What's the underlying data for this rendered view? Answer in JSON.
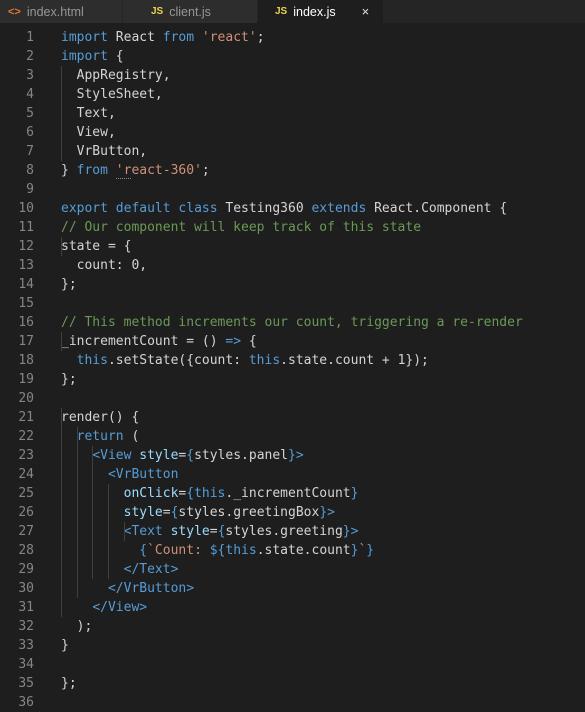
{
  "tabs": [
    {
      "label": "index.html",
      "icon": "<>",
      "type": "html"
    },
    {
      "label": "client.js",
      "icon": "JS",
      "type": "js"
    },
    {
      "label": "index.js",
      "icon": "JS",
      "type": "js",
      "active": true,
      "close": "×"
    }
  ],
  "lines": [
    [
      [
        "kw",
        "import"
      ],
      [
        "p",
        " React "
      ],
      [
        "kw",
        "from"
      ],
      [
        "p",
        " "
      ],
      [
        "str",
        "'react'"
      ],
      [
        "p",
        ";"
      ]
    ],
    [
      [
        "kw",
        "import"
      ],
      [
        "p",
        " {"
      ]
    ],
    [
      [
        "p",
        "  AppRegistry,"
      ]
    ],
    [
      [
        "p",
        "  StyleSheet,"
      ]
    ],
    [
      [
        "p",
        "  Text,"
      ]
    ],
    [
      [
        "p",
        "  View,"
      ]
    ],
    [
      [
        "p",
        "  VrButton,"
      ]
    ],
    [
      [
        "p",
        "} "
      ],
      [
        "kw",
        "from"
      ],
      [
        "p",
        " "
      ],
      [
        "strsq",
        "'r"
      ],
      [
        "str",
        "eact-360'"
      ],
      [
        "p",
        ";"
      ]
    ],
    [],
    [
      [
        "kw",
        "export"
      ],
      [
        "p",
        " "
      ],
      [
        "kw",
        "default"
      ],
      [
        "p",
        " "
      ],
      [
        "kw",
        "class"
      ],
      [
        "p",
        " Testing360 "
      ],
      [
        "kw",
        "extends"
      ],
      [
        "p",
        " React.Component {"
      ]
    ],
    [
      [
        "cm",
        "// Our component will keep track of this state"
      ]
    ],
    [
      [
        "p",
        "state = {"
      ]
    ],
    [
      [
        "p",
        "  count: 0,"
      ]
    ],
    [
      [
        "p",
        "};"
      ]
    ],
    [],
    [
      [
        "cm",
        "// This method increments our count, triggering a re-render"
      ]
    ],
    [
      [
        "p",
        "_incrementCount = () "
      ],
      [
        "kw",
        "=>"
      ],
      [
        "p",
        " {"
      ]
    ],
    [
      [
        "p",
        "  "
      ],
      [
        "kw",
        "this"
      ],
      [
        "p",
        ".setState({count: "
      ],
      [
        "kw",
        "this"
      ],
      [
        "p",
        ".state.count + 1});"
      ]
    ],
    [
      [
        "p",
        "};"
      ]
    ],
    [],
    [
      [
        "p",
        "render() {"
      ]
    ],
    [
      [
        "p",
        "  "
      ],
      [
        "kw",
        "return"
      ],
      [
        "p",
        " ("
      ]
    ],
    [
      [
        "p",
        "    "
      ],
      [
        "tag",
        "<View"
      ],
      [
        "p",
        " "
      ],
      [
        "attr",
        "style"
      ],
      [
        "p",
        "="
      ],
      [
        "kw",
        "{"
      ],
      [
        "p",
        "styles.panel"
      ],
      [
        "kw",
        "}"
      ],
      [
        "tag",
        ">"
      ]
    ],
    [
      [
        "p",
        "      "
      ],
      [
        "tag",
        "<VrButton"
      ]
    ],
    [
      [
        "p",
        "        "
      ],
      [
        "attr",
        "onClick"
      ],
      [
        "p",
        "="
      ],
      [
        "kw",
        "{this"
      ],
      [
        "p",
        "._incrementCount"
      ],
      [
        "kw",
        "}"
      ]
    ],
    [
      [
        "p",
        "        "
      ],
      [
        "attr",
        "style"
      ],
      [
        "p",
        "="
      ],
      [
        "kw",
        "{"
      ],
      [
        "p",
        "styles.greetingBox"
      ],
      [
        "kw",
        "}"
      ],
      [
        "tag",
        ">"
      ]
    ],
    [
      [
        "p",
        "        "
      ],
      [
        "tag",
        "<Text"
      ],
      [
        "p",
        " "
      ],
      [
        "attr",
        "style"
      ],
      [
        "p",
        "="
      ],
      [
        "kw",
        "{"
      ],
      [
        "p",
        "styles.greeting"
      ],
      [
        "kw",
        "}"
      ],
      [
        "tag",
        ">"
      ]
    ],
    [
      [
        "p",
        "          "
      ],
      [
        "kw",
        "{"
      ],
      [
        "str",
        "`Count: "
      ],
      [
        "kw",
        "${this"
      ],
      [
        "p",
        ".state.count"
      ],
      [
        "kw",
        "}"
      ],
      [
        "str",
        "`"
      ],
      [
        "kw",
        "}"
      ]
    ],
    [
      [
        "p",
        "        "
      ],
      [
        "tag",
        "</Text>"
      ]
    ],
    [
      [
        "p",
        "      "
      ],
      [
        "tag",
        "</VrButton>"
      ]
    ],
    [
      [
        "p",
        "    "
      ],
      [
        "tag",
        "</View>"
      ]
    ],
    [
      [
        "p",
        "  );"
      ]
    ],
    [
      [
        "p",
        "}"
      ]
    ],
    [],
    [
      [
        "p",
        "};"
      ]
    ],
    []
  ]
}
